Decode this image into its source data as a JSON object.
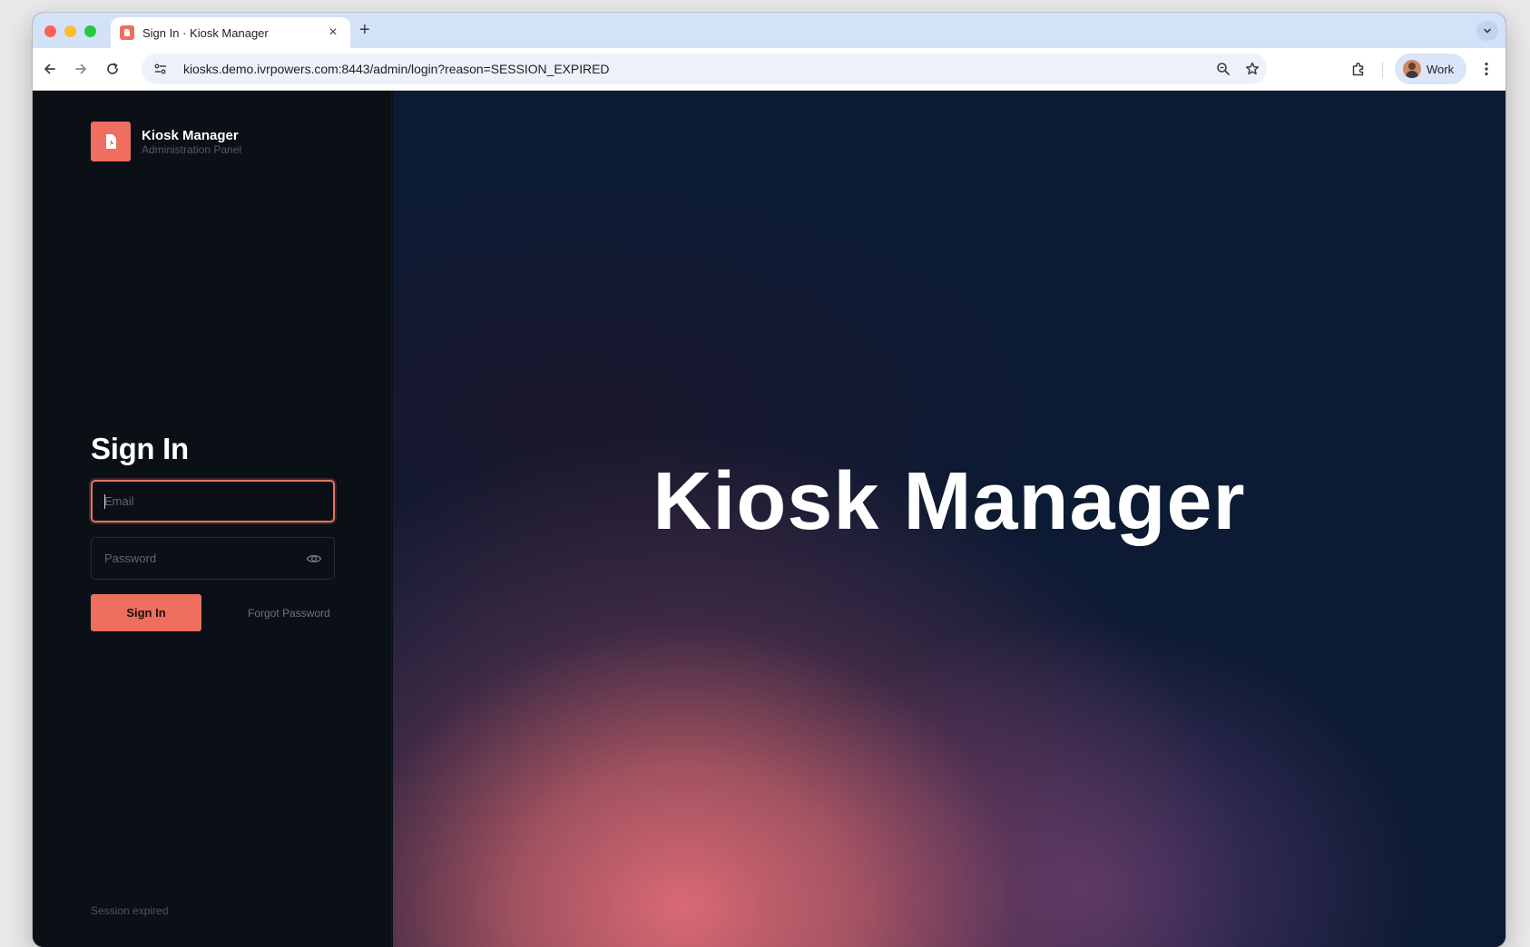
{
  "browser": {
    "tab": {
      "title": "Sign In · Kiosk Manager",
      "close_glyph": "×"
    },
    "new_tab_glyph": "+",
    "url": "kiosks.demo.ivrpowers.com:8443/admin/login?reason=SESSION_EXPIRED",
    "profile_label": "Work",
    "icons": [
      "back-arrow-icon",
      "forward-arrow-icon",
      "reload-icon",
      "site-info-icon",
      "zoom-icon",
      "bookmark-star-icon",
      "extensions-icon",
      "more-vert-icon",
      "tab-list-chevron-icon"
    ]
  },
  "sidebar": {
    "brand_name": "Kiosk Manager",
    "brand_subtitle": "Administration Panel",
    "heading": "Sign In",
    "email_placeholder": "Email",
    "password_placeholder": "Password",
    "signin_label": "Sign In",
    "forgot_label": "Forgot Password",
    "status_text": "Session expired"
  },
  "hero": {
    "title": "Kiosk Manager"
  },
  "colors": {
    "accent": "#ee6e5f",
    "sidebar_bg": "#0b0f16",
    "hero_bg": "#0c1a33"
  }
}
